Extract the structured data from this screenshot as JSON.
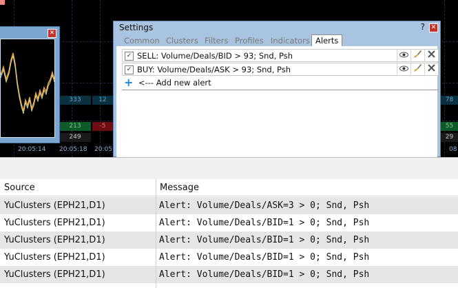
{
  "chart": {
    "time_labels": [
      "20:05:14",
      "20:05:18",
      "20:05:",
      "08"
    ],
    "clusters": [
      {
        "text": "333",
        "color": "#5fa4c9",
        "bg": "#0b3140"
      },
      {
        "text": "12",
        "color": "#5fa4c9",
        "bg": "#0b3140"
      },
      {
        "text": "213",
        "color": "#89c48a",
        "bg": "#0e5a2a"
      },
      {
        "text": "-5",
        "color": "#e07070",
        "bg": "#6b0d12"
      },
      {
        "text": "249",
        "color": "#c8c8c8",
        "bg": "#1a1a1a"
      },
      {
        "text": "78",
        "color": "#5fa4c9",
        "bg": "#0b3140"
      },
      {
        "text": "55",
        "color": "#89c48a",
        "bg": "#0e5a2a"
      },
      {
        "text": "29",
        "color": "#c8c8c8",
        "bg": "#1a1a1a"
      }
    ]
  },
  "settings": {
    "title": "Settings",
    "help": "?",
    "close": "✕",
    "tabs": [
      "Common",
      "Clusters",
      "Filters",
      "Profiles",
      "Indicators",
      "Alerts"
    ],
    "active_tab": "Alerts",
    "alerts": [
      {
        "checked": true,
        "text": "SELL: Volume/Deals/BID > 93; Snd, Psh"
      },
      {
        "checked": true,
        "text": "BUY: Volume/Deals/ASK > 93; Snd, Psh"
      }
    ],
    "add_label": "<--- Add new alert"
  },
  "mini_window": {
    "close": "✕"
  },
  "table": {
    "headers": {
      "source": "Source",
      "message": "Message"
    },
    "rows": [
      {
        "source": "YuClusters (EPH21,D1)",
        "message": "Alert: Volume/Deals/ASK=3 > 0; Snd, Psh"
      },
      {
        "source": "YuClusters (EPH21,D1)",
        "message": "Alert: Volume/Deals/BID=1 > 0; Snd, Psh"
      },
      {
        "source": "YuClusters (EPH21,D1)",
        "message": "Alert: Volume/Deals/BID=1 > 0; Snd, Psh"
      },
      {
        "source": "YuClusters (EPH21,D1)",
        "message": "Alert: Volume/Deals/BID=1 > 0; Snd, Psh"
      },
      {
        "source": "YuClusters (EPH21,D1)",
        "message": "Alert: Volume/Deals/BID=1 > 0; Snd, Psh"
      }
    ]
  },
  "icons": {
    "view": "eye-icon",
    "edit": "brush-icon",
    "delete": "delete-icon",
    "add": "plus-icon",
    "check": "✓"
  }
}
